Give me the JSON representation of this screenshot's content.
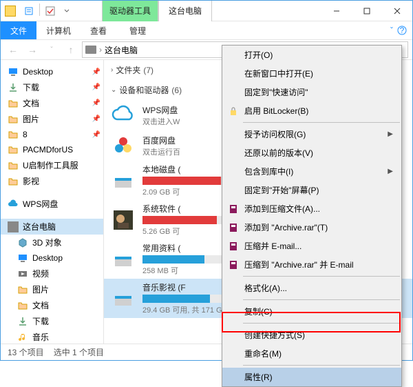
{
  "window": {
    "title": "这台电脑",
    "tool_tab": "驱动器工具"
  },
  "ribbon": {
    "file": "文件",
    "computer": "计算机",
    "view": "查看",
    "manage": "管理"
  },
  "breadcrumb": {
    "location": "这台电脑"
  },
  "sidebar": {
    "quick": [
      {
        "label": "Desktop",
        "icon": "desktop",
        "pin": true
      },
      {
        "label": "下载",
        "icon": "download",
        "pin": true
      },
      {
        "label": "文档",
        "icon": "folder",
        "pin": true
      },
      {
        "label": "图片",
        "icon": "folder",
        "pin": true
      },
      {
        "label": "8",
        "icon": "folder",
        "pin": true
      },
      {
        "label": "PACMDforUS",
        "icon": "folder",
        "pin": false
      },
      {
        "label": "U启制作工具服",
        "icon": "folder",
        "pin": false
      },
      {
        "label": "影视",
        "icon": "folder",
        "pin": false
      }
    ],
    "wps": "WPS网盘",
    "thispc": "这台电脑",
    "pc_children": [
      {
        "label": "3D 对象",
        "icon": "cube"
      },
      {
        "label": "Desktop",
        "icon": "desktop"
      },
      {
        "label": "视频",
        "icon": "video"
      },
      {
        "label": "图片",
        "icon": "folder"
      },
      {
        "label": "文档",
        "icon": "folder"
      },
      {
        "label": "下载",
        "icon": "download"
      },
      {
        "label": "音乐",
        "icon": "music"
      }
    ]
  },
  "main": {
    "folders_hdr": "文件夹",
    "folders_count": "(7)",
    "drives_hdr": "设备和驱动器",
    "drives_count": "(6)",
    "drives": [
      {
        "name": "WPS网盘",
        "sub": "双击进入W"
      },
      {
        "name": "百度网盘",
        "sub": "双击运行百"
      },
      {
        "name": "本地磁盘 (",
        "fill": 95,
        "sub": "2.09 GB 可"
      },
      {
        "name": "系统软件 (",
        "fill": 90,
        "sub": "5.26 GB 可"
      },
      {
        "name": "常用资料 (",
        "fill": 75,
        "sub": "258 MB 可"
      },
      {
        "name": "音乐影视 (F",
        "fill": 82,
        "sub": "29.4 GB 可用, 共 171 GB",
        "selected": true
      }
    ]
  },
  "context_menu": {
    "items": [
      {
        "label": "打开(O)"
      },
      {
        "label": "在新窗口中打开(E)"
      },
      {
        "label": "固定到\"快速访问\""
      },
      {
        "label": "启用 BitLocker(B)",
        "icon": "bitlocker"
      },
      {
        "sep": true
      },
      {
        "label": "授予访问权限(G)",
        "arrow": true
      },
      {
        "label": "还原以前的版本(V)"
      },
      {
        "label": "包含到库中(I)",
        "arrow": true
      },
      {
        "label": "固定到\"开始\"屏幕(P)"
      },
      {
        "label": "添加到压缩文件(A)...",
        "icon": "rar"
      },
      {
        "label": "添加到 \"Archive.rar\"(T)",
        "icon": "rar"
      },
      {
        "label": "压缩并 E-mail...",
        "icon": "rar"
      },
      {
        "label": "压缩到 \"Archive.rar\" 并 E-mail",
        "icon": "rar"
      },
      {
        "sep": true
      },
      {
        "label": "格式化(A)..."
      },
      {
        "sep": true
      },
      {
        "label": "复制(C)"
      },
      {
        "sep": true
      },
      {
        "label": "创建快捷方式(S)"
      },
      {
        "label": "重命名(M)"
      },
      {
        "sep": true
      },
      {
        "label": "属性(R)",
        "highlighted": true
      }
    ]
  },
  "statusbar": {
    "left": "13 个项目",
    "right": "选中 1 个项目"
  }
}
